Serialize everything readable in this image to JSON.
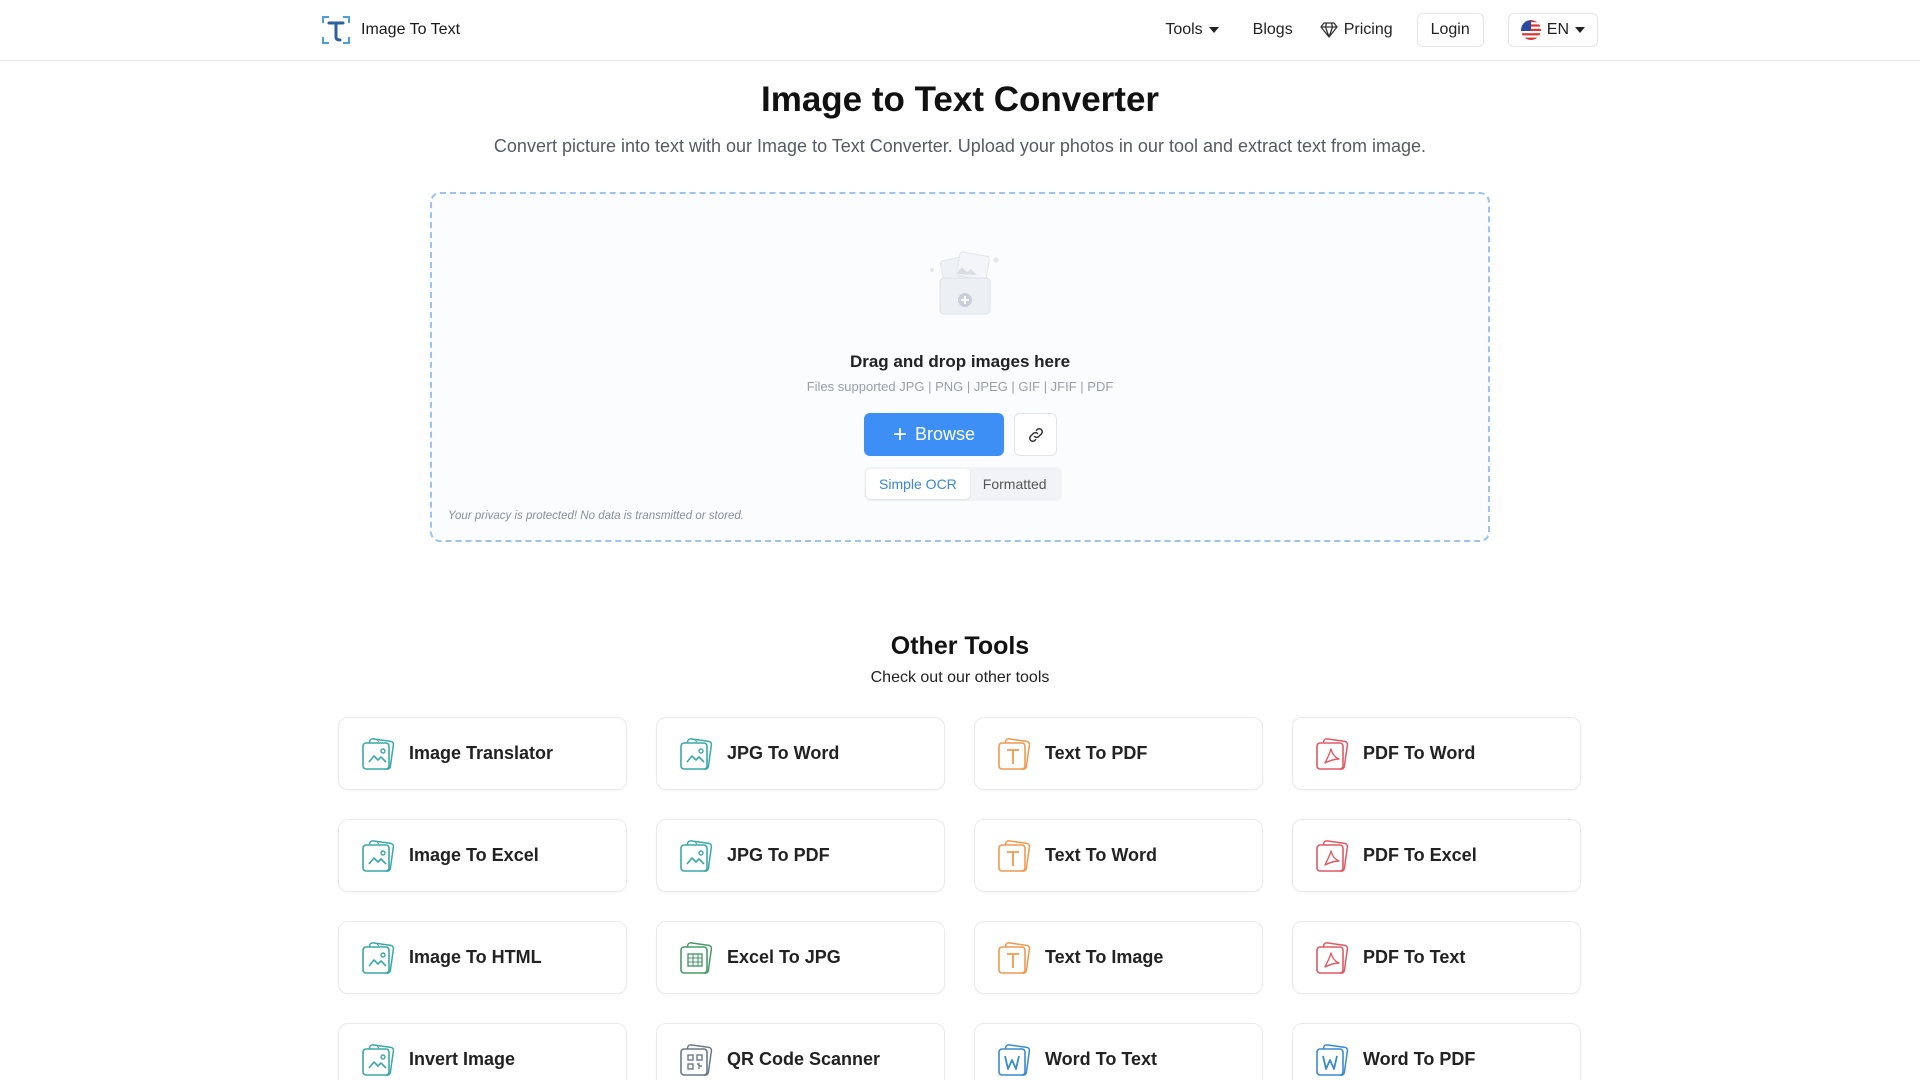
{
  "header": {
    "brand_name": "Image To Text",
    "nav": {
      "tools": "Tools",
      "blogs": "Blogs",
      "pricing": "Pricing",
      "login": "Login",
      "language": "EN"
    }
  },
  "hero": {
    "title": "Image to Text Converter",
    "subtitle": "Convert picture into text with our Image to Text Converter. Upload your photos in our tool and extract text from image."
  },
  "upload": {
    "drop_title": "Drag and drop images here",
    "formats": "Files supported JPG | PNG | JPEG | GIF | JFIF | PDF",
    "browse_label": "Browse",
    "modes": [
      "Simple OCR",
      "Formatted"
    ],
    "active_mode": "Simple OCR",
    "privacy": "Your privacy is protected! No data is transmitted or stored."
  },
  "other_tools": {
    "title": "Other Tools",
    "subtitle": "Check out our other tools",
    "tools": [
      {
        "label": "Image Translator",
        "icon": "image-file-icon",
        "color": "#3aa8a8"
      },
      {
        "label": "JPG To Word",
        "icon": "image-file-icon",
        "color": "#3aa8a8"
      },
      {
        "label": "Text To PDF",
        "icon": "text-file-icon",
        "color": "#f0994e"
      },
      {
        "label": "PDF To Word",
        "icon": "pdf-file-icon",
        "color": "#e05a66"
      },
      {
        "label": "Image To Excel",
        "icon": "image-file-icon",
        "color": "#3aa8a8"
      },
      {
        "label": "JPG To PDF",
        "icon": "image-file-icon",
        "color": "#3aa8a8"
      },
      {
        "label": "Text To Word",
        "icon": "text-file-icon",
        "color": "#f0994e"
      },
      {
        "label": "PDF To Excel",
        "icon": "pdf-file-icon",
        "color": "#e05a66"
      },
      {
        "label": "Image To HTML",
        "icon": "image-file-icon",
        "color": "#3aa8a8"
      },
      {
        "label": "Excel To JPG",
        "icon": "excel-file-icon",
        "color": "#4a9a6a"
      },
      {
        "label": "Text To Image",
        "icon": "text-file-icon",
        "color": "#f0994e"
      },
      {
        "label": "PDF To Text",
        "icon": "pdf-file-icon",
        "color": "#e05a66"
      },
      {
        "label": "Invert Image",
        "icon": "image-file-icon",
        "color": "#3aa8a8"
      },
      {
        "label": "QR Code Scanner",
        "icon": "qr-file-icon",
        "color": "#6a7a8a"
      },
      {
        "label": "Word To Text",
        "icon": "word-file-icon",
        "color": "#3a8ad0"
      },
      {
        "label": "Word To PDF",
        "icon": "word-file-icon",
        "color": "#3a8ad0"
      }
    ]
  },
  "colors": {
    "accent": "#3d8ff5",
    "dropzone_border": "#9cc4ef",
    "active_mode_text": "#3a86d9"
  }
}
